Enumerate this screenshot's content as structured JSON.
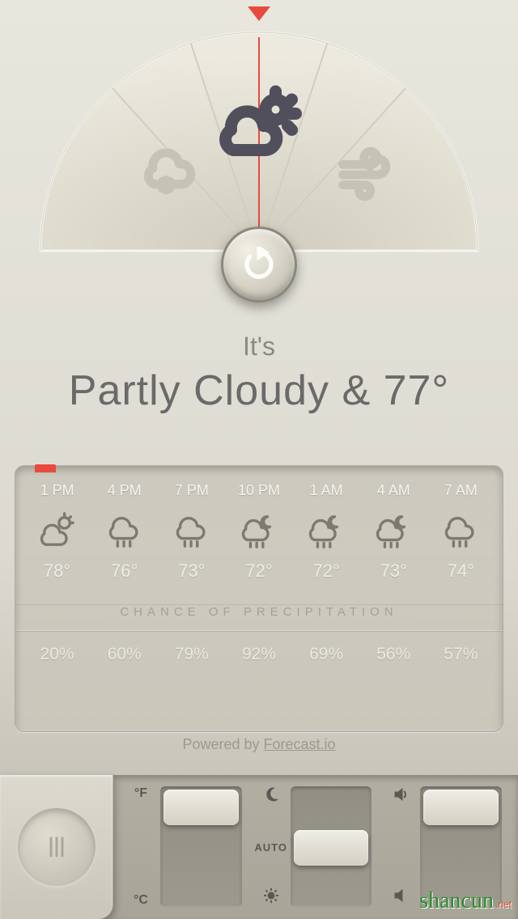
{
  "dial": {
    "left_icon": "snow-cloud-icon",
    "center_icon": "partly-cloudy-icon",
    "right_icon": "wind-icon"
  },
  "headline": {
    "prefix": "It's",
    "condition": "Partly Cloudy & 77°"
  },
  "forecast": {
    "precip_label": "CHANCE OF PRECIPITATION",
    "hours": [
      {
        "time": "1 PM",
        "icon": "partly-cloudy",
        "temp": "78°",
        "precip": "20%"
      },
      {
        "time": "4 PM",
        "icon": "rain",
        "temp": "76°",
        "precip": "60%"
      },
      {
        "time": "7 PM",
        "icon": "rain",
        "temp": "73°",
        "precip": "79%"
      },
      {
        "time": "10 PM",
        "icon": "night-rain",
        "temp": "72°",
        "precip": "92%"
      },
      {
        "time": "1 AM",
        "icon": "night-rain",
        "temp": "72°",
        "precip": "69%"
      },
      {
        "time": "4 AM",
        "icon": "night-rain",
        "temp": "73°",
        "precip": "56%"
      },
      {
        "time": "7 AM",
        "icon": "rain",
        "temp": "74°",
        "precip": "57%"
      }
    ]
  },
  "attribution": {
    "prefix": "Powered by",
    "provider": "Forecast.io"
  },
  "controls": {
    "unit": {
      "top": "°F",
      "bottom": "°C",
      "value": 0
    },
    "brightness": {
      "top_icon": "moon",
      "mid": "AUTO",
      "bottom_icon": "sun",
      "value": 50
    },
    "volume": {
      "top_icon": "volume-high",
      "bottom_icon": "volume-low",
      "value": 5
    }
  },
  "watermark": {
    "main": "shancun",
    "sub": ".net"
  }
}
